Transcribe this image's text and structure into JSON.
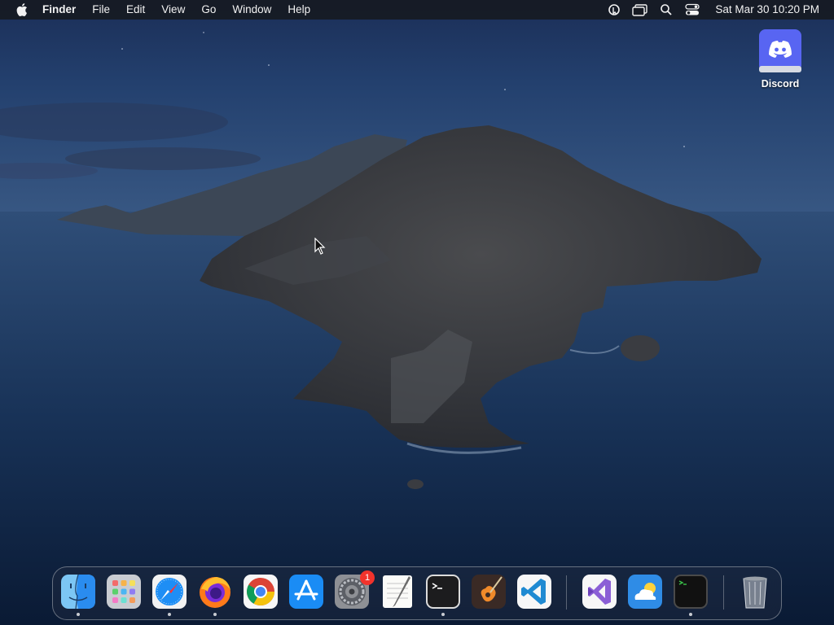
{
  "menubar": {
    "apple_icon": "apple-logo-icon",
    "app_name": "Finder",
    "menus": [
      "File",
      "Edit",
      "View",
      "Go",
      "Window"
    ],
    "help": "Help",
    "status_icons": [
      "cursor-pro-icon",
      "window-switcher-icon",
      "spotlight-search-icon",
      "control-center-icon"
    ],
    "clock": "Sat Mar 30  10:20 PM"
  },
  "desktop": {
    "icons": [
      {
        "label": "Discord",
        "icon": "discord-icon",
        "color": "#5865F2"
      }
    ]
  },
  "dock": {
    "apps": [
      {
        "name": "Finder",
        "icon": "finder-icon",
        "running": true
      },
      {
        "name": "Launchpad",
        "icon": "launchpad-icon",
        "running": false
      },
      {
        "name": "Safari",
        "icon": "safari-icon",
        "running": true
      },
      {
        "name": "Firefox",
        "icon": "firefox-icon",
        "running": true
      },
      {
        "name": "Google Chrome",
        "icon": "chrome-icon",
        "running": false
      },
      {
        "name": "App Store",
        "icon": "app-store-icon",
        "running": false
      },
      {
        "name": "System Preferences",
        "icon": "system-preferences-icon",
        "running": false,
        "badge": "1"
      },
      {
        "name": "TextEdit",
        "icon": "textedit-icon",
        "running": false
      },
      {
        "name": "Terminal",
        "icon": "terminal-icon",
        "running": true
      },
      {
        "name": "GarageBand",
        "icon": "garageband-icon",
        "running": false
      },
      {
        "name": "Visual Studio Code",
        "icon": "vscode-icon",
        "running": false
      }
    ],
    "recent": [
      {
        "name": "Visual Studio",
        "icon": "visual-studio-icon",
        "running": false
      },
      {
        "name": "Weather",
        "icon": "weather-icon",
        "running": false
      },
      {
        "name": "Script Editor",
        "icon": "terminal-dark-icon",
        "running": true
      }
    ],
    "trash": {
      "name": "Trash",
      "icon": "trash-icon"
    }
  }
}
